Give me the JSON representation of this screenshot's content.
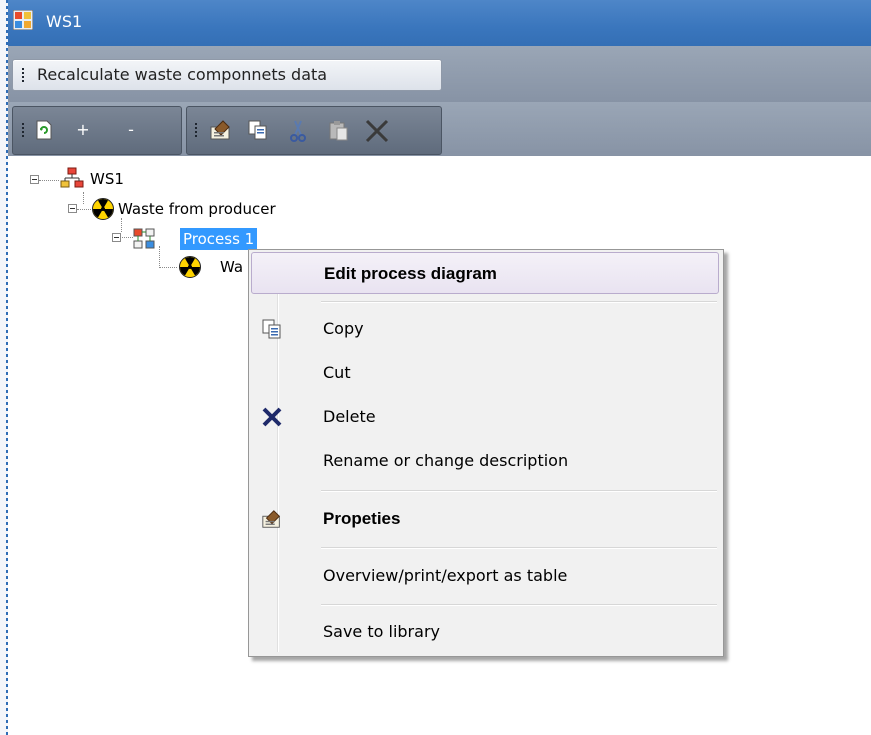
{
  "window": {
    "title": "WS1"
  },
  "toolbar1": {
    "recalc_label": "Recalculate waste componnets data"
  },
  "toolbar2": {
    "add_label": "+",
    "remove_label": "-"
  },
  "tree": {
    "root": "WS1",
    "child": "Waste from producer",
    "process": "Process 1",
    "subchild": "Wa"
  },
  "context_menu": {
    "edit_diagram": "Edit process diagram",
    "copy": "Copy",
    "cut": "Cut",
    "delete": "Delete",
    "rename": "Rename or change description",
    "properties": "Propeties",
    "overview": "Overview/print/export as table",
    "save": "Save to library"
  },
  "icons": {
    "app": "app-icon",
    "refresh": "refresh-icon",
    "properties": "properties-icon",
    "copy": "copy-icon",
    "cut": "cut-icon",
    "paste": "paste-icon",
    "delete": "delete-icon",
    "network": "network-icon",
    "radiation": "radiation-icon",
    "process": "process-icon"
  },
  "colors": {
    "titlebar": "#3a76bd",
    "selection": "#3399ff",
    "toolbar_band": "#8793a5"
  }
}
